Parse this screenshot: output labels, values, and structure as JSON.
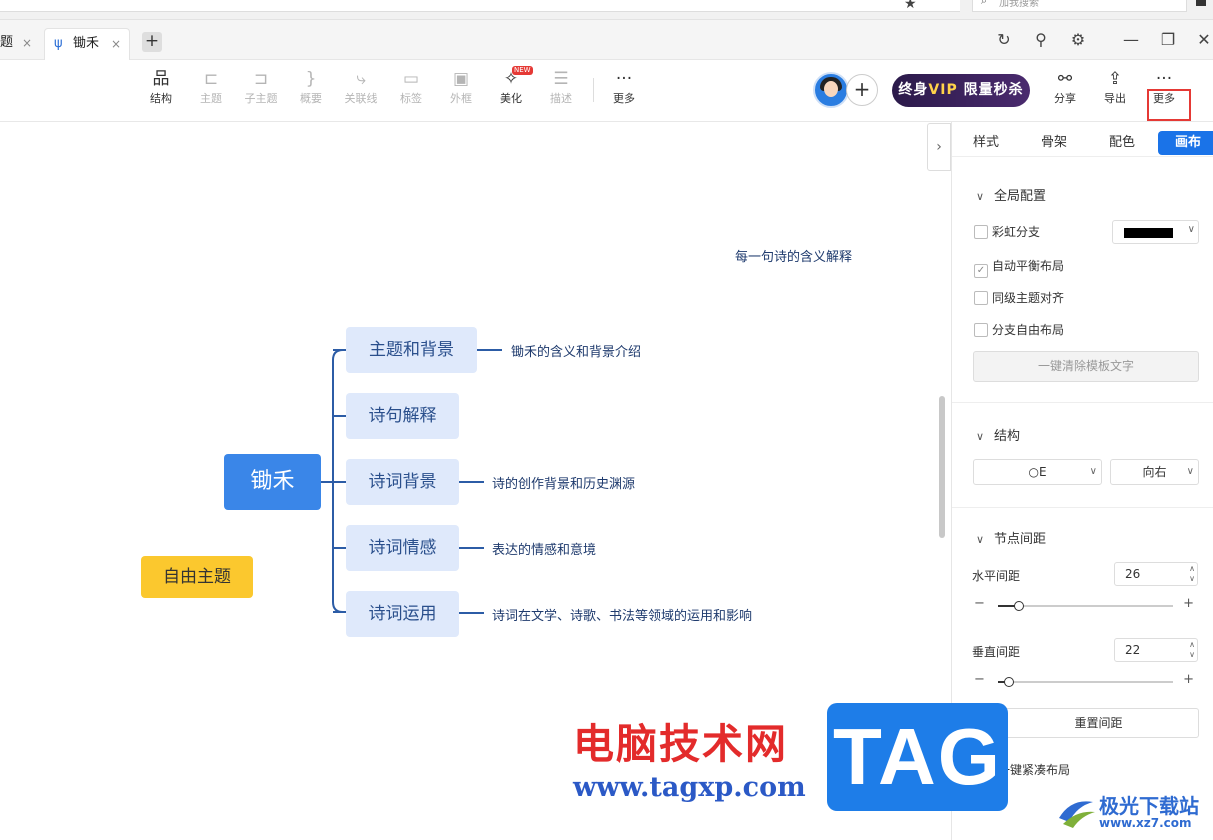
{
  "browser": {
    "search_placeholder": "加我搜索"
  },
  "tabs": [
    {
      "label": "题",
      "close": "×"
    },
    {
      "label": "锄禾",
      "close": "×"
    }
  ],
  "tab_add": "+",
  "toolbar": {
    "tools": [
      {
        "label": "结构",
        "icon": "structure-icon",
        "glyph": "品",
        "disabled": false
      },
      {
        "label": "主题",
        "icon": "topic-icon",
        "glyph": "⊏",
        "disabled": true
      },
      {
        "label": "子主题",
        "icon": "subtopic-icon",
        "glyph": "⊐",
        "disabled": true
      },
      {
        "label": "概要",
        "icon": "summary-icon",
        "glyph": "}",
        "disabled": true
      },
      {
        "label": "关联线",
        "icon": "relation-line-icon",
        "glyph": "⤷",
        "disabled": true
      },
      {
        "label": "标签",
        "icon": "tag-icon",
        "glyph": "▭",
        "disabled": true
      },
      {
        "label": "外框",
        "icon": "frame-icon",
        "glyph": "▣",
        "disabled": true
      },
      {
        "label": "美化",
        "icon": "magic-wand-icon",
        "glyph": "✧",
        "disabled": false,
        "badge": "NEW"
      },
      {
        "label": "描述",
        "icon": "description-icon",
        "glyph": "☰",
        "disabled": true
      },
      {
        "label": "更多",
        "icon": "more-icon",
        "glyph": "···",
        "disabled": false
      }
    ],
    "vip_text_pre": "终身",
    "vip_text_vip": "VIP",
    "vip_text_post": "限量秒杀",
    "right_tools": [
      {
        "label": "分享",
        "icon": "share-icon",
        "glyph": "⚯"
      },
      {
        "label": "导出",
        "icon": "export-icon",
        "glyph": "⇪"
      },
      {
        "label": "更多",
        "icon": "more-icon",
        "glyph": "···"
      }
    ]
  },
  "mindmap": {
    "root": "锄禾",
    "branches": [
      {
        "label": "主题和背景",
        "note": "锄禾的含义和背景介绍"
      },
      {
        "label": "诗句解释",
        "note": ""
      },
      {
        "label": "诗词背景",
        "note": "诗的创作背景和历史渊源"
      },
      {
        "label": "诗词情感",
        "note": "表达的情感和意境"
      },
      {
        "label": "诗词运用",
        "note": "诗词在文学、诗歌、书法等领域的运用和影响"
      }
    ],
    "floating_note": "每一句诗的含义解释",
    "free_topic": "自由主题"
  },
  "panel": {
    "tabs": [
      "样式",
      "骨架",
      "配色",
      "画布"
    ],
    "active_tab": "画布",
    "global": {
      "title": "全局配置",
      "rainbow": {
        "label": "彩虹分支",
        "checked": false
      },
      "branch_color": "#000000",
      "auto_balance": {
        "label": "自动平衡布局",
        "checked": true
      },
      "align_same_level": {
        "label": "同级主题对齐",
        "checked": false
      },
      "free_layout": {
        "label": "分支自由布局",
        "checked": false
      },
      "clear_button": "一键清除模板文字"
    },
    "structure": {
      "title": "结构",
      "layout_value": "○E",
      "direction_value": "向右"
    },
    "spacing": {
      "title": "节点间距",
      "horizontal_label": "水平间距",
      "horizontal_value": "26",
      "horizontal_fraction": 0.12,
      "vertical_label": "垂直间距",
      "vertical_value": "22",
      "vertical_fraction": 0.06,
      "reset_button": "重置间距",
      "compact_label": "一键紧凑布局"
    }
  },
  "watermark": {
    "site_cn": "电脑技术网",
    "site_url": "www.tagxp.com",
    "tag": "TAG",
    "logo_name": "极光下载站",
    "logo_domain": "www.xz7.com"
  }
}
